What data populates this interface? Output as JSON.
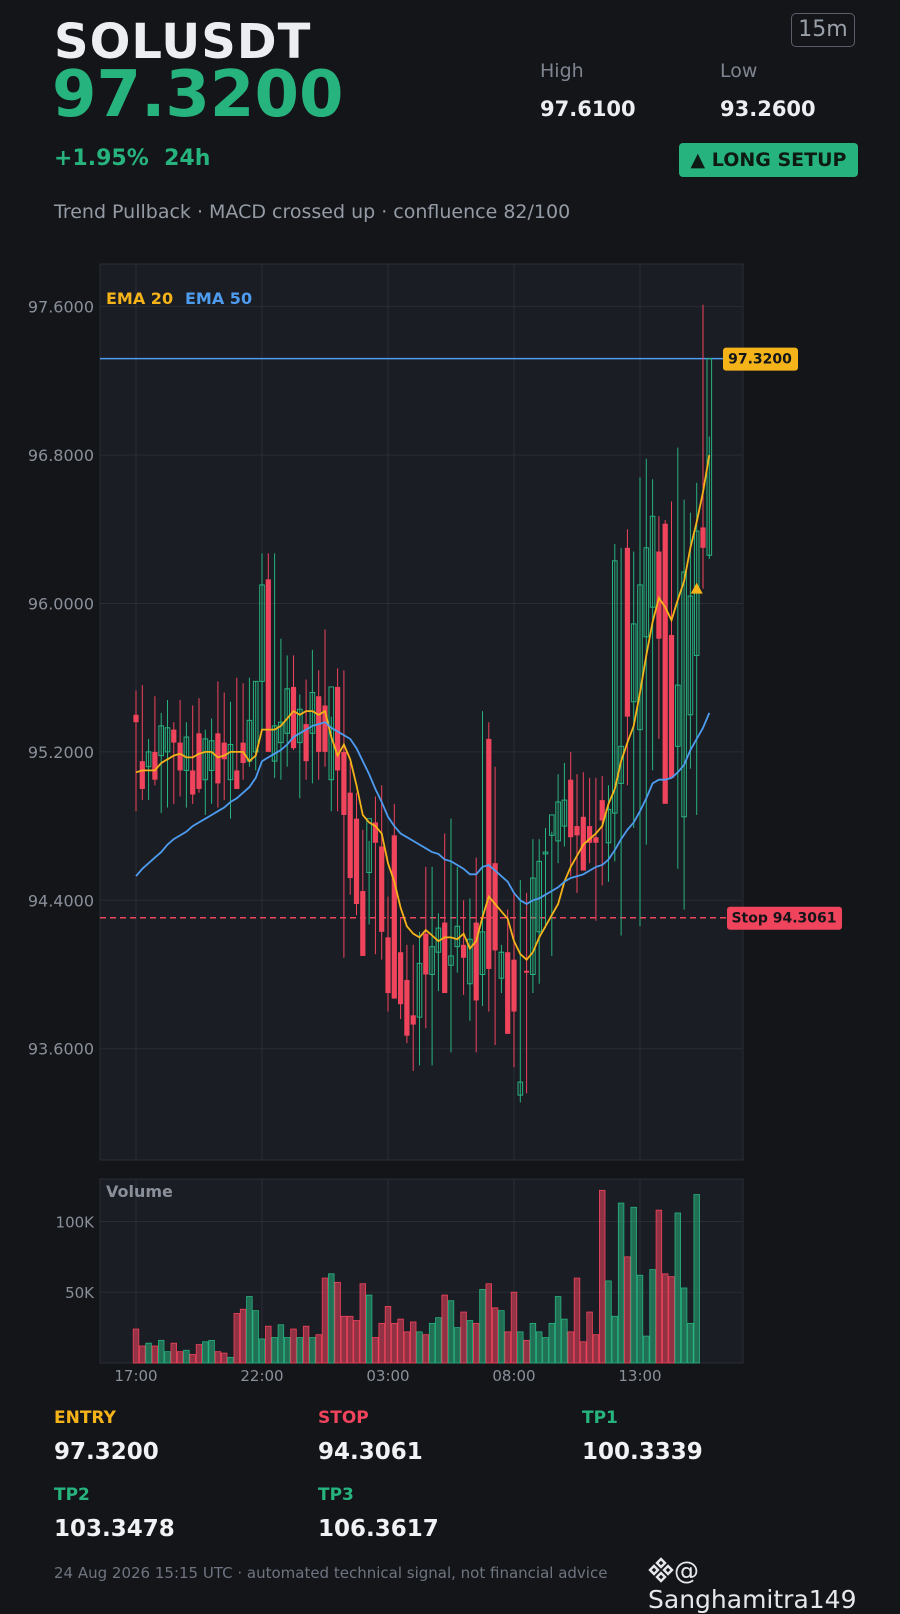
{
  "header": {
    "symbol": "SOLUSDT",
    "price": "97.3200",
    "change": "+1.95%",
    "change_period": "24h",
    "timeframe": "15m",
    "high_label": "High",
    "high_value": "97.6100",
    "low_label": "Low",
    "low_value": "93.2600",
    "signal_badge": "▲ LONG SETUP",
    "subtitle": "Trend Pullback · MACD crossed up · confluence 82/100"
  },
  "colors": {
    "bull": "#27b37e",
    "bear": "#f0435c",
    "ema20": "#f5b31a",
    "ema50": "#4d9cf0",
    "entry": "#f5b31a",
    "stop": "#f0435c",
    "tp": "#27b37e",
    "panel_bg": "#1b1d24",
    "page_bg": "#131519"
  },
  "chart_data": [
    {
      "type": "candlestick",
      "title": "",
      "legend": [
        {
          "name": "EMA 20",
          "color": "#f5b31a"
        },
        {
          "name": "EMA 50",
          "color": "#4d9cf0"
        }
      ],
      "legend_placement": "top-left",
      "grid": true,
      "y_ticks": [
        "97.6000",
        "96.8000",
        "96.0000",
        "95.2000",
        "94.4000",
        "93.6000"
      ],
      "ylim": [
        93.0,
        97.83
      ],
      "x_ticks": [
        "17:00",
        "22:00",
        "03:00",
        "08:00",
        "13:00"
      ],
      "x_tick_index": [
        0,
        20,
        40,
        60,
        80
      ],
      "price_line": {
        "value": 97.32,
        "label": "97.3200"
      },
      "stop_line": {
        "value": 94.3061,
        "label": "Stop 94.3061"
      },
      "signal_marker": {
        "index": 89,
        "value": 96.08
      },
      "series": [
        {
          "name": "EMA 20",
          "values": [
            95.09,
            95.1,
            95.1,
            95.1,
            95.14,
            95.16,
            95.18,
            95.19,
            95.17,
            95.17,
            95.19,
            95.2,
            95.2,
            95.17,
            95.18,
            95.2,
            95.2,
            95.2,
            95.15,
            95.18,
            95.32,
            95.32,
            95.32,
            95.34,
            95.38,
            95.42,
            95.4,
            95.42,
            95.42,
            95.4,
            95.42,
            95.28,
            95.18,
            95.24,
            95.16,
            95.02,
            94.86,
            94.82,
            94.8,
            94.76,
            94.6,
            94.5,
            94.36,
            94.26,
            94.22,
            94.2,
            94.24,
            94.21,
            94.18,
            94.2,
            94.2,
            94.19,
            94.22,
            94.14,
            94.18,
            94.31,
            94.42,
            94.38,
            94.34,
            94.3,
            94.18,
            94.11,
            94.08,
            94.12,
            94.2,
            94.26,
            94.32,
            94.38,
            94.5,
            94.58,
            94.64,
            94.7,
            94.73,
            94.76,
            94.8,
            94.92,
            95.0,
            95.15,
            95.25,
            95.34,
            95.52,
            95.72,
            95.9,
            96.03,
            95.98,
            95.91,
            96.02,
            96.12,
            96.3,
            96.44,
            96.6,
            96.8
          ]
        },
        {
          "name": "EMA 50",
          "values": [
            94.53,
            94.57,
            94.6,
            94.63,
            94.66,
            94.7,
            94.73,
            94.75,
            94.77,
            94.8,
            94.82,
            94.84,
            94.86,
            94.88,
            94.9,
            94.93,
            94.95,
            94.98,
            95.01,
            95.06,
            95.15,
            95.17,
            95.19,
            95.21,
            95.24,
            95.28,
            95.3,
            95.32,
            95.34,
            95.35,
            95.36,
            95.33,
            95.31,
            95.29,
            95.27,
            95.22,
            95.15,
            95.08,
            95.0,
            94.93,
            94.85,
            94.8,
            94.76,
            94.74,
            94.72,
            94.7,
            94.68,
            94.66,
            94.65,
            94.62,
            94.61,
            94.59,
            94.57,
            94.54,
            94.54,
            94.58,
            94.59,
            94.56,
            94.53,
            94.5,
            94.44,
            94.4,
            94.38,
            94.4,
            94.41,
            94.43,
            94.45,
            94.47,
            94.5,
            94.52,
            94.53,
            94.54,
            94.56,
            94.58,
            94.59,
            94.62,
            94.67,
            94.73,
            94.78,
            94.82,
            94.88,
            94.95,
            95.03,
            95.05,
            95.05,
            95.06,
            95.09,
            95.13,
            95.21,
            95.27,
            95.33,
            95.41
          ]
        },
        {
          "name": "OHLC",
          "open": [
            95.4,
            95.15,
            95.12,
            95.2,
            95.18,
            95.2,
            95.32,
            95.25,
            95.1,
            95.1,
            95.3,
            95.05,
            95.1,
            95.3,
            95.25,
            95.05,
            95.1,
            95.25,
            95.15,
            95.2,
            95.58,
            96.13,
            95.15,
            95.25,
            95.3,
            95.55,
            95.25,
            95.35,
            95.3,
            95.5,
            95.45,
            95.05,
            95.55,
            95.2,
            94.98,
            94.84,
            94.45,
            94.55,
            94.82,
            94.69,
            94.2,
            94.75,
            94.12,
            93.97,
            93.78,
            93.77,
            94.22,
            94.0,
            94.12,
            94.28,
            94.05,
            94.15,
            94.16,
            93.95,
            94.28,
            94.0,
            95.27,
            94.6,
            93.98,
            94.12,
            94.08,
            93.35,
            94.02,
            94.0,
            94.23,
            94.65,
            94.75,
            94.72,
            94.8,
            95.05,
            94.8,
            94.85,
            94.8,
            94.74,
            94.94,
            94.71,
            94.87,
            95.03,
            96.3,
            95.47,
            95.32,
            95.82,
            95.98,
            96.28,
            96.43,
            95.83,
            95.23,
            94.85,
            95.4,
            95.72,
            96.41,
            96.26
          ],
          "high": [
            95.53,
            95.56,
            95.27,
            95.5,
            95.41,
            95.48,
            95.36,
            95.48,
            95.36,
            95.45,
            95.49,
            95.32,
            95.38,
            95.58,
            95.52,
            95.47,
            95.6,
            95.57,
            95.6,
            95.58,
            96.27,
            96.27,
            96.27,
            95.81,
            95.72,
            95.72,
            95.51,
            95.59,
            95.75,
            95.64,
            95.86,
            95.39,
            95.65,
            95.64,
            95.14,
            94.98,
            94.78,
            94.72,
            94.96,
            95.02,
            94.42,
            94.92,
            94.3,
            94.16,
            94.16,
            94.23,
            94.58,
            94.58,
            94.33,
            94.76,
            94.84,
            94.58,
            94.4,
            94.41,
            94.63,
            95.42,
            95.36,
            95.12,
            94.16,
            94.35,
            94.44,
            94.51,
            94.44,
            94.73,
            94.73,
            94.79,
            94.77,
            95.08,
            95.14,
            95.2,
            95.08,
            95.09,
            95.06,
            95.06,
            95.07,
            95.02,
            96.32,
            96.3,
            96.4,
            96.28,
            96.68,
            96.78,
            96.67,
            96.47,
            96.45,
            96.55,
            96.84,
            96.56,
            96.49,
            96.65,
            97.61,
            96.9
          ],
          "low": [
            94.88,
            94.94,
            94.94,
            95.02,
            94.87,
            94.9,
            94.92,
            94.96,
            94.9,
            94.92,
            94.98,
            94.86,
            94.92,
            94.9,
            94.94,
            94.84,
            95.0,
            95.05,
            95.12,
            95.1,
            95.31,
            95.21,
            95.06,
            95.05,
            95.12,
            95.21,
            94.95,
            95.05,
            95.03,
            95.05,
            95.12,
            94.88,
            94.88,
            94.09,
            94.43,
            94.32,
            94.13,
            94.27,
            94.11,
            94.08,
            93.8,
            94.01,
            93.76,
            93.63,
            93.48,
            93.51,
            93.71,
            93.51,
            93.91,
            93.94,
            93.58,
            94.01,
            93.89,
            93.75,
            93.58,
            93.83,
            93.8,
            93.62,
            93.9,
            93.9,
            93.5,
            93.31,
            93.36,
            93.9,
            93.95,
            94.25,
            94.1,
            94.6,
            94.69,
            94.53,
            94.44,
            94.61,
            94.6,
            94.29,
            94.48,
            94.5,
            94.61,
            94.21,
            95.02,
            94.79,
            94.26,
            94.7,
            95.1,
            95.27,
            95.46,
            95.43,
            94.57,
            94.35,
            95.11,
            94.86,
            96.08,
            96.24
          ],
          "close": [
            95.36,
            95.0,
            95.2,
            95.05,
            95.34,
            95.33,
            95.25,
            95.1,
            95.28,
            94.97,
            95.0,
            95.27,
            95.26,
            95.03,
            95.16,
            95.24,
            95.0,
            95.14,
            95.37,
            95.58,
            96.1,
            95.2,
            95.34,
            95.36,
            95.54,
            95.22,
            95.43,
            95.15,
            95.52,
            95.2,
            95.2,
            95.55,
            95.1,
            94.86,
            94.52,
            94.38,
            94.1,
            94.84,
            94.71,
            94.23,
            93.9,
            93.87,
            93.84,
            93.67,
            93.73,
            94.06,
            94.0,
            94.15,
            94.25,
            93.9,
            94.1,
            94.26,
            94.09,
            94.19,
            93.86,
            94.23,
            94.03,
            94.13,
            94.12,
            93.68,
            93.8,
            93.42,
            94.01,
            94.52,
            94.61,
            94.66,
            94.86,
            94.93,
            94.94,
            94.74,
            94.75,
            94.56,
            94.71,
            94.71,
            94.83,
            94.89,
            96.23,
            95.23,
            95.39,
            95.89,
            96.1,
            96.3,
            96.47,
            95.81,
            94.92,
            95.06,
            95.56,
            96.17,
            96.04,
            96.39,
            96.3,
            97.32
          ]
        }
      ]
    },
    {
      "type": "bar",
      "title": "Volume",
      "grid": true,
      "y_ticks": [
        "100K",
        "50K"
      ],
      "ylim": [
        0,
        130000
      ],
      "values": [
        24000,
        12000,
        14000,
        12000,
        16000,
        8000,
        14000,
        8000,
        9000,
        6000,
        13000,
        15000,
        16000,
        8000,
        7000,
        4000,
        35000,
        38000,
        47000,
        37000,
        17000,
        26000,
        18000,
        27000,
        18000,
        24000,
        18000,
        26000,
        18000,
        20000,
        60000,
        63000,
        57000,
        33000,
        33000,
        30000,
        56000,
        48000,
        18000,
        28000,
        40000,
        28000,
        31000,
        22000,
        29000,
        22000,
        20000,
        28000,
        32000,
        48000,
        44000,
        25000,
        36000,
        30000,
        28000,
        52000,
        56000,
        39000,
        37000,
        22000,
        50000,
        22000,
        16000,
        28000,
        22000,
        18000,
        28000,
        47000,
        31000,
        22000,
        60000,
        15000,
        36000,
        20000,
        122000,
        58000,
        33000,
        113000,
        75000,
        110000,
        62000,
        19000,
        66000,
        108000,
        63000,
        61000,
        106000,
        53000,
        28000,
        119000
      ],
      "bar_colors_follow_candles": true
    }
  ],
  "levels": [
    {
      "label": "ENTRY",
      "value": "97.3200",
      "color": "#f5b31a"
    },
    {
      "label": "STOP",
      "value": "94.3061",
      "color": "#f0435c"
    },
    {
      "label": "TP1",
      "value": "100.3339",
      "color": "#27b37e"
    },
    {
      "label": "TP2",
      "value": "103.3478",
      "color": "#27b37e"
    },
    {
      "label": "TP3",
      "value": "106.3617",
      "color": "#27b37e"
    }
  ],
  "footer": {
    "note": "24 Aug 2026 15:15 UTC  ·  automated technical signal, not financial advice",
    "watermark": "@ Sanghamitra149",
    "watermark_icon": "binance-logo-icon"
  }
}
